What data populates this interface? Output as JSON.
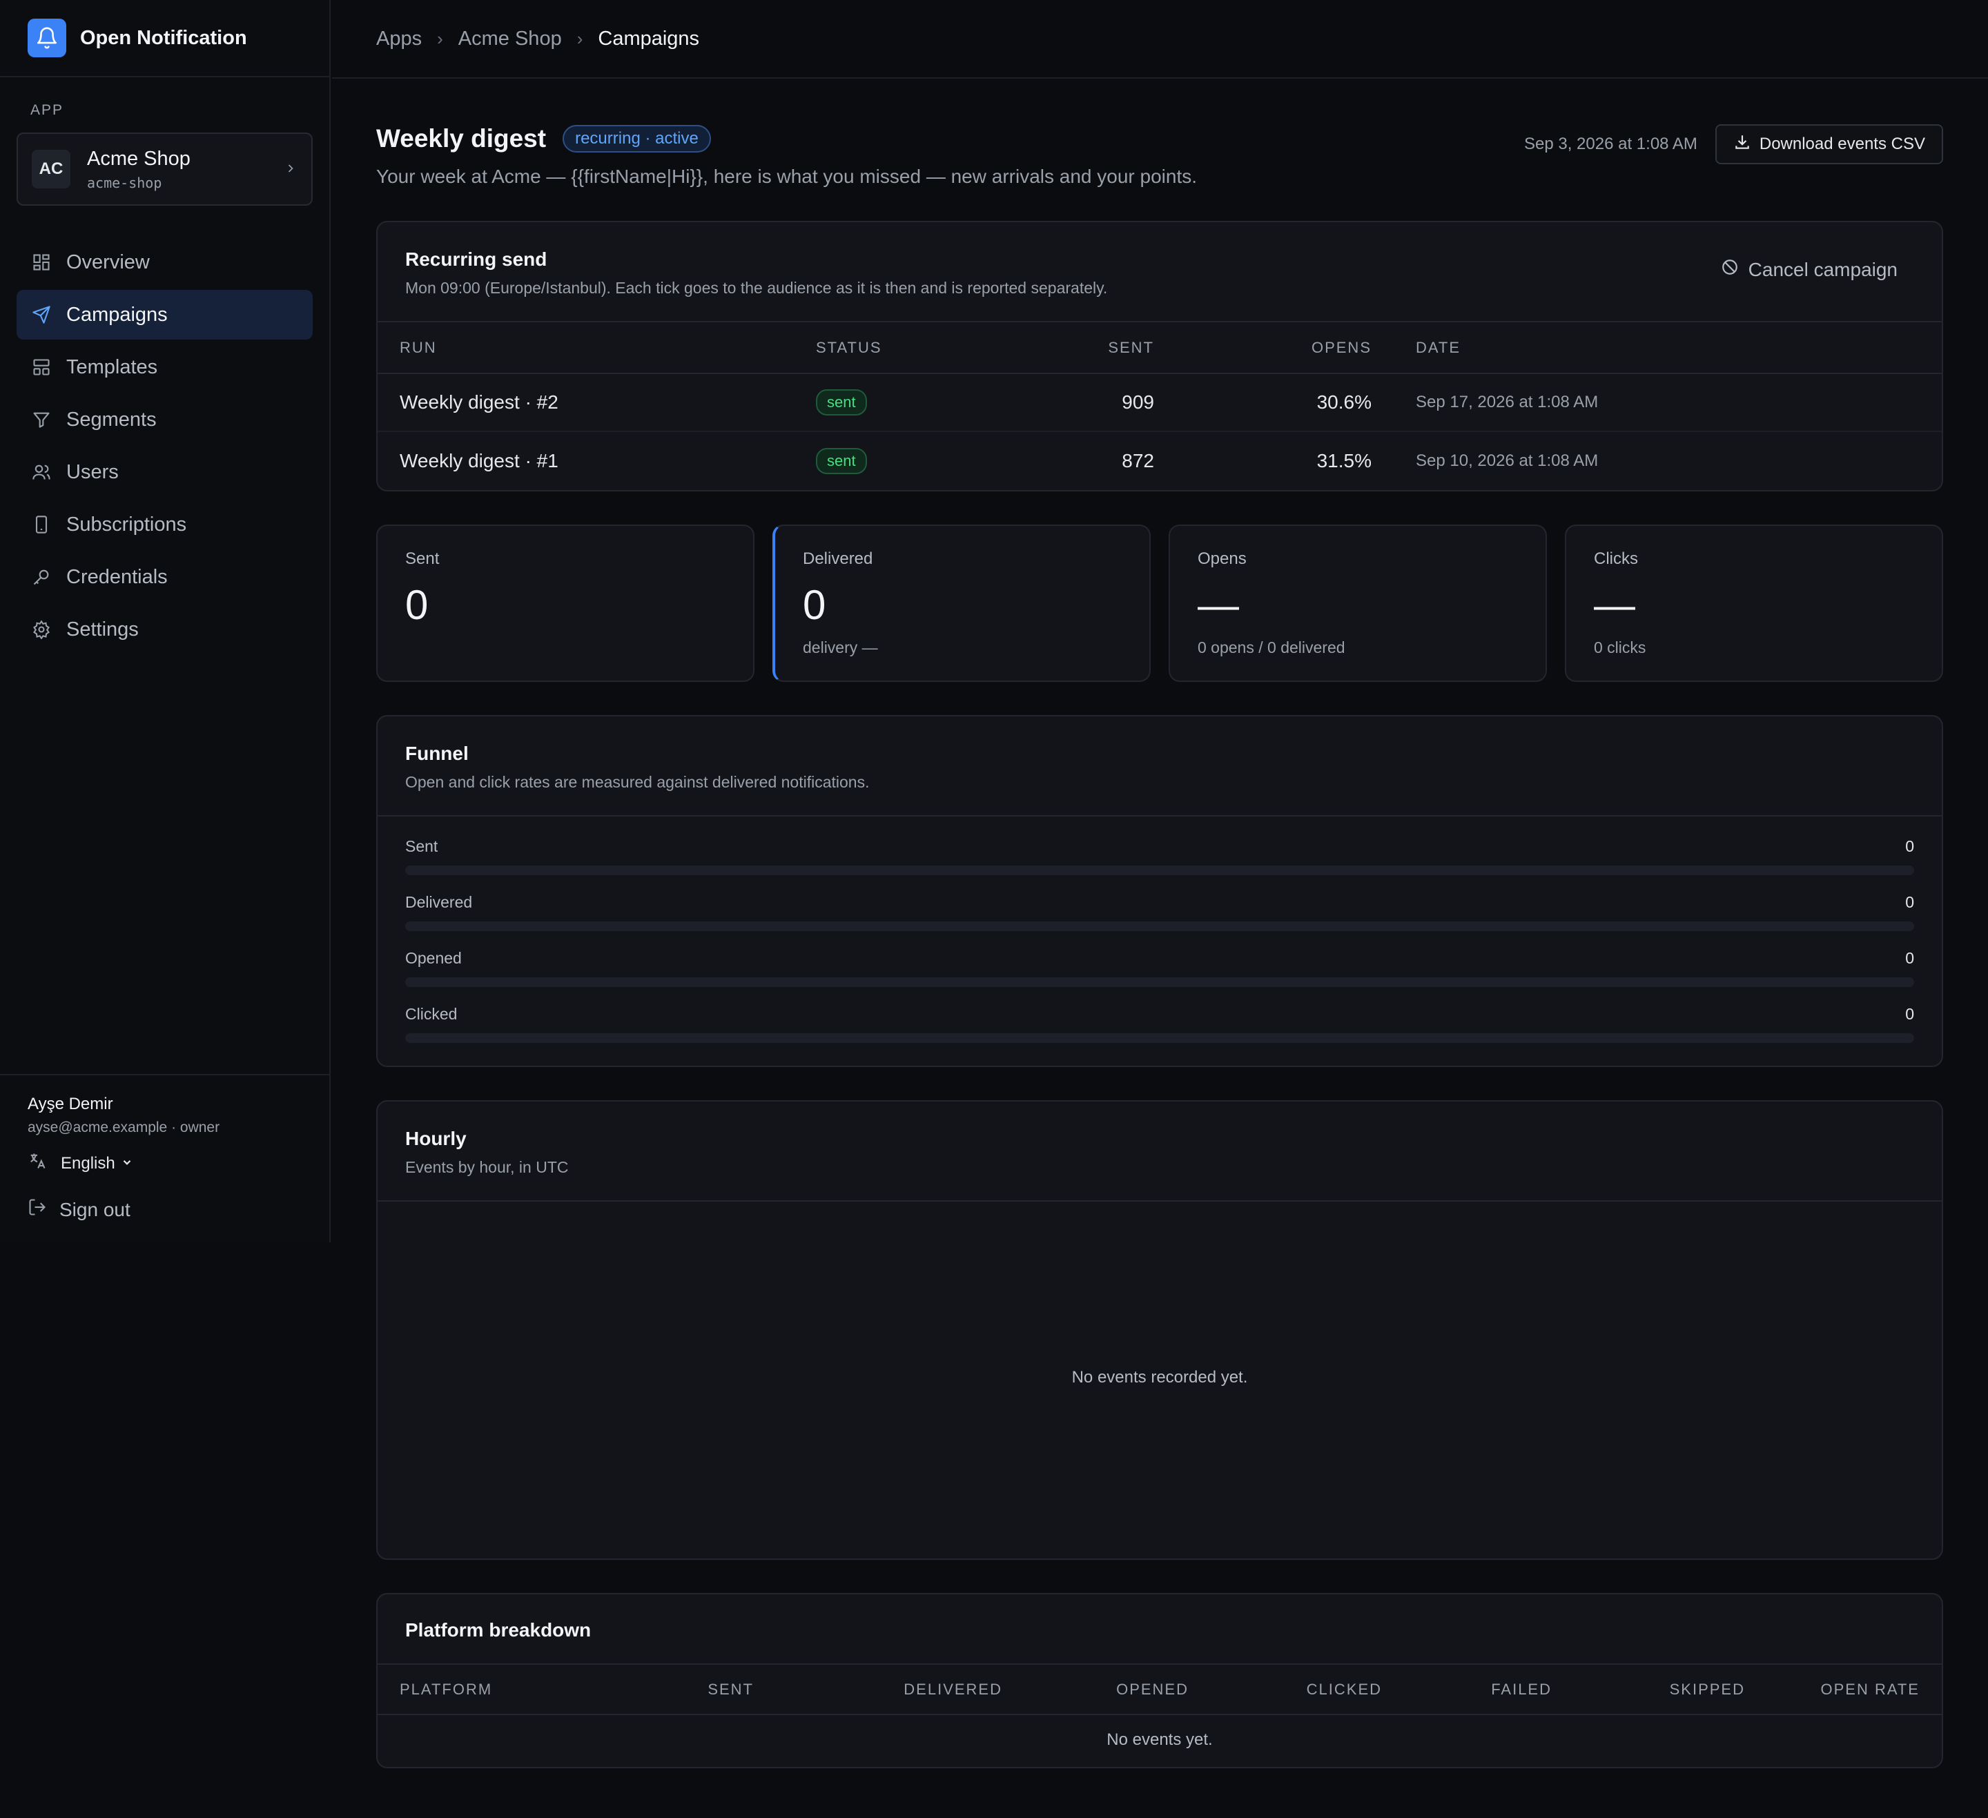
{
  "brand": {
    "name": "Open Notification",
    "icon": "bell-icon"
  },
  "sidebar": {
    "section_label": "APP",
    "app": {
      "avatar": "AC",
      "name": "Acme Shop",
      "slug": "acme-shop"
    },
    "items": [
      {
        "label": "Overview",
        "icon": "grid-icon"
      },
      {
        "label": "Campaigns",
        "icon": "send-icon",
        "active": true
      },
      {
        "label": "Templates",
        "icon": "layout-icon"
      },
      {
        "label": "Segments",
        "icon": "filter-icon"
      },
      {
        "label": "Users",
        "icon": "users-icon"
      },
      {
        "label": "Subscriptions",
        "icon": "device-icon"
      },
      {
        "label": "Credentials",
        "icon": "key-icon"
      },
      {
        "label": "Settings",
        "icon": "gear-icon"
      }
    ],
    "user": {
      "name": "Ayşe Demir",
      "meta": "ayse@acme.example · owner"
    },
    "language": "English",
    "sign_out": "Sign out"
  },
  "breadcrumb": [
    "Apps",
    "Acme Shop",
    "Campaigns"
  ],
  "campaign": {
    "title": "Weekly digest",
    "status_pill": "recurring · active",
    "subtitle": "Your week at Acme — {{firstName|Hi}}, here is what you missed — new arrivals and your points.",
    "date": "Sep 3, 2026 at 1:08 AM",
    "download_label": "Download events CSV"
  },
  "recurring": {
    "title": "Recurring send",
    "subtitle": "Mon 09:00 (Europe/Istanbul). Each tick goes to the audience as it is then and is reported separately.",
    "cancel_label": "Cancel campaign",
    "columns": [
      "RUN",
      "STATUS",
      "SENT",
      "OPENS",
      "DATE"
    ],
    "rows": [
      {
        "run": "Weekly digest · #2",
        "status": "sent",
        "sent": "909",
        "opens": "30.6%",
        "date": "Sep 17, 2026 at 1:08 AM"
      },
      {
        "run": "Weekly digest · #1",
        "status": "sent",
        "sent": "872",
        "opens": "31.5%",
        "date": "Sep 10, 2026 at 1:08 AM"
      }
    ]
  },
  "stats": [
    {
      "label": "Sent",
      "value": "0",
      "meta": ""
    },
    {
      "label": "Delivered",
      "value": "0",
      "meta": "delivery —"
    },
    {
      "label": "Opens",
      "value": "—",
      "meta": "0 opens / 0 delivered"
    },
    {
      "label": "Clicks",
      "value": "—",
      "meta": "0 clicks"
    }
  ],
  "funnel": {
    "title": "Funnel",
    "subtitle": "Open and click rates are measured against delivered notifications.",
    "rows": [
      {
        "label": "Sent",
        "value": "0",
        "fraction": 0
      },
      {
        "label": "Delivered",
        "value": "0",
        "fraction": 0
      },
      {
        "label": "Opened",
        "value": "0",
        "fraction": 0
      },
      {
        "label": "Clicked",
        "value": "0",
        "fraction": 0
      }
    ]
  },
  "hourly": {
    "title": "Hourly",
    "subtitle": "Events by hour, in UTC",
    "empty": "No events recorded yet."
  },
  "platform": {
    "title": "Platform breakdown",
    "columns": [
      "PLATFORM",
      "SENT",
      "DELIVERED",
      "OPENED",
      "CLICKED",
      "FAILED",
      "SKIPPED",
      "OPEN RATE"
    ],
    "empty": "No events yet."
  },
  "colors": {
    "accent": "#3b82f6",
    "success": "#4ade80",
    "background": "#0b0c0f"
  }
}
